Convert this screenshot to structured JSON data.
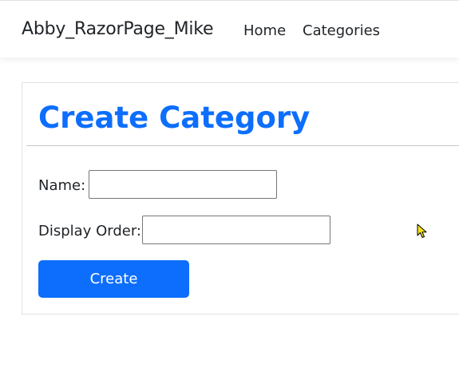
{
  "navbar": {
    "brand": "Abby_RazorPage_Mike",
    "links": [
      {
        "label": "Home"
      },
      {
        "label": "Categories"
      }
    ]
  },
  "form": {
    "title": "Create Category",
    "fields": [
      {
        "label": "Name:",
        "value": ""
      },
      {
        "label": "Display Order:",
        "value": ""
      }
    ],
    "submit_label": "Create"
  },
  "colors": {
    "primary": "#0d6efd",
    "text": "#212529",
    "border": "#dee2e6"
  },
  "icons": {
    "cursor": "mouse-pointer-icon"
  }
}
